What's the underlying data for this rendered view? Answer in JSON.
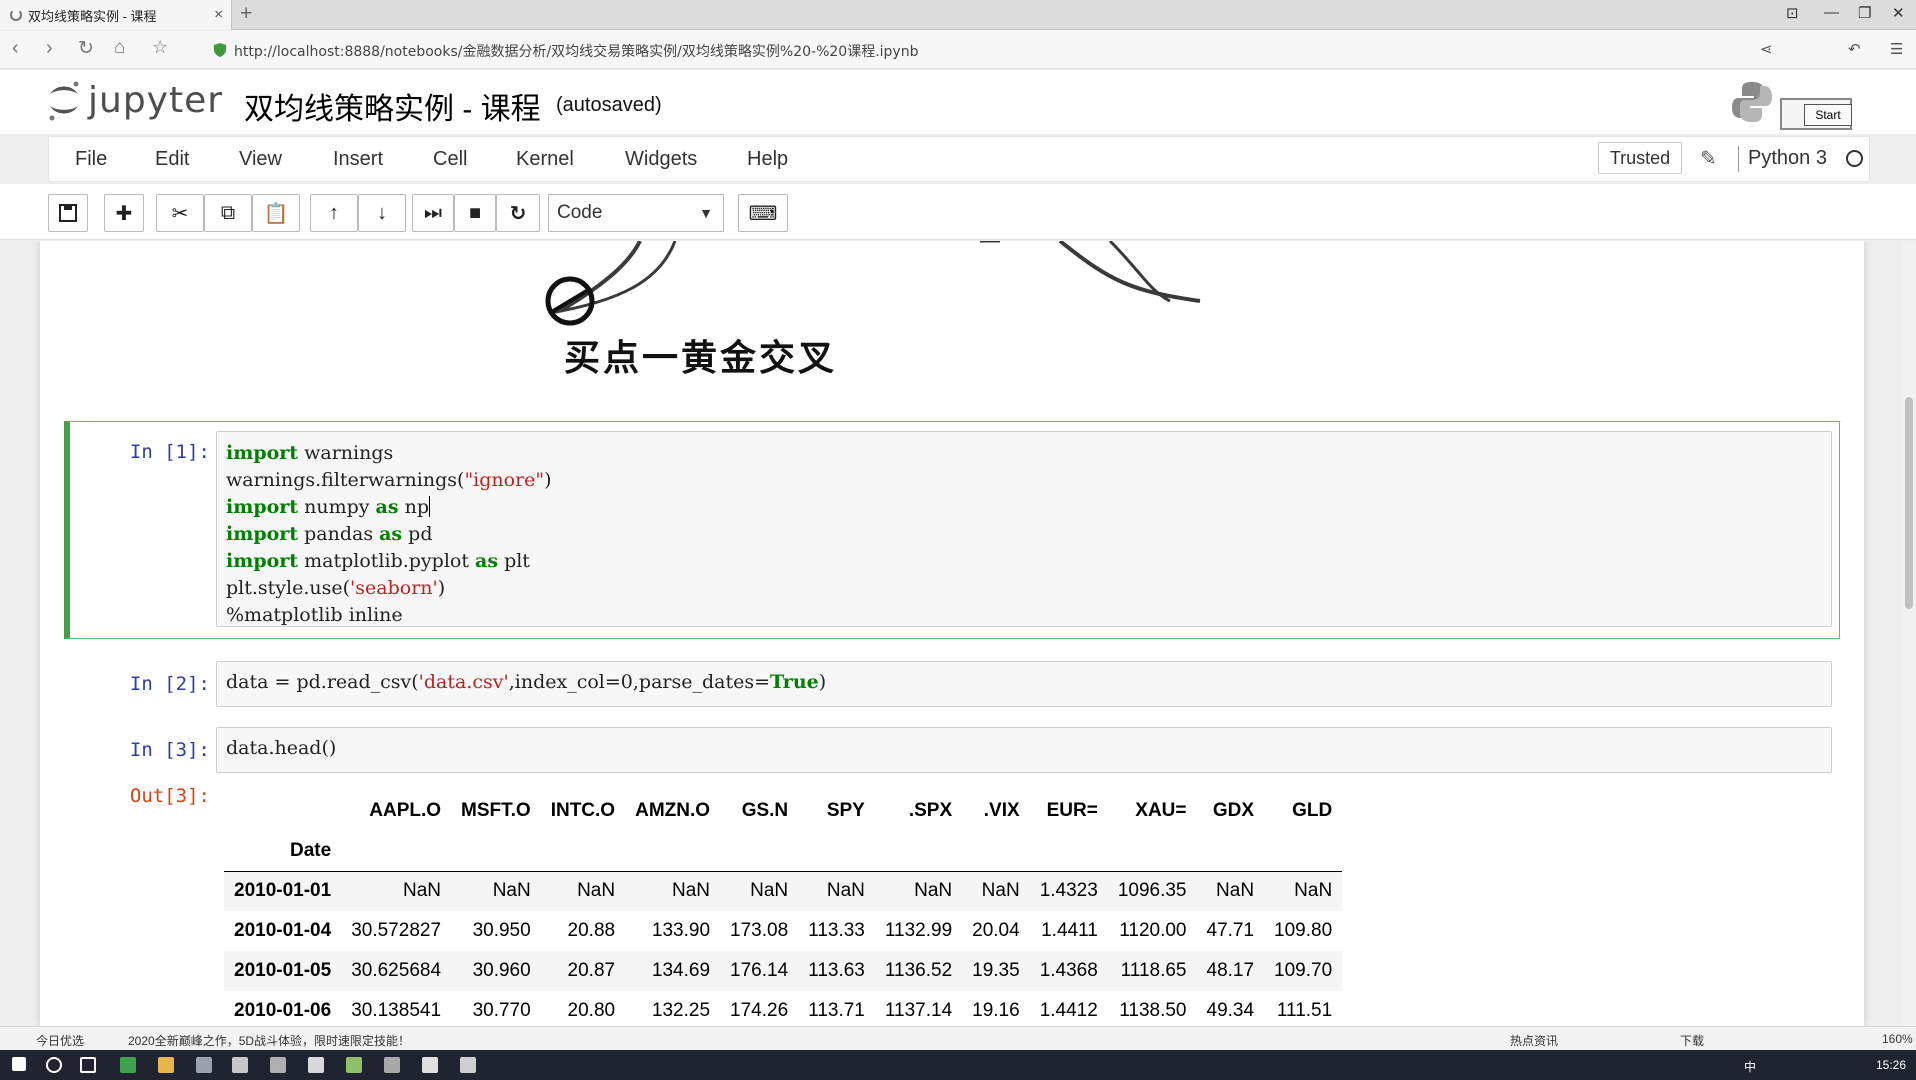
{
  "browser": {
    "tab_title": "双均线策略实例 - 课程",
    "tab_close": "×",
    "new_tab": "+",
    "url": "http://localhost:8888/notebooks/金融数据分析/双均线交易策略实例/双均线策略实例%20-%20课程.ipynb"
  },
  "jupyter": {
    "logo_text": "jupyter",
    "notebook_title": "双均线策略实例 - 课程",
    "autosaved": "(autosaved)",
    "start_label": "Start"
  },
  "menu": [
    "File",
    "Edit",
    "View",
    "Insert",
    "Cell",
    "Kernel",
    "Widgets",
    "Help"
  ],
  "trusted_label": "Trusted",
  "kernel_name": "Python 3",
  "toolbar": {
    "cell_type": "Code"
  },
  "figure": {
    "caption": "买点一黄金交叉"
  },
  "cells": [
    {
      "prompt": "In  [1]:",
      "lines": [
        "import warnings",
        "warnings.filterwarnings(\"ignore\")",
        "import numpy as np",
        "import pandas as pd",
        "import matplotlib.pyplot as plt",
        "plt.style.use('seaborn')",
        "%matplotlib inline"
      ]
    },
    {
      "prompt": "In  [2]:",
      "lines": [
        "data = pd.read_csv('data.csv',index_col=0,parse_dates=True)"
      ]
    },
    {
      "prompt": "In  [3]:",
      "lines": [
        "data.head()"
      ]
    }
  ],
  "output": {
    "prompt": "Out[3]:",
    "index_name": "Date",
    "columns": [
      "AAPL.O",
      "MSFT.O",
      "INTC.O",
      "AMZN.O",
      "GS.N",
      "SPY",
      ".SPX",
      ".VIX",
      "EUR=",
      "XAU=",
      "GDX",
      "GLD"
    ],
    "rows": [
      {
        "index": "2010-01-01",
        "values": [
          "NaN",
          "NaN",
          "NaN",
          "NaN",
          "NaN",
          "NaN",
          "NaN",
          "NaN",
          "1.4323",
          "1096.35",
          "NaN",
          "NaN"
        ]
      },
      {
        "index": "2010-01-04",
        "values": [
          "30.572827",
          "30.950",
          "20.88",
          "133.90",
          "173.08",
          "113.33",
          "1132.99",
          "20.04",
          "1.4411",
          "1120.00",
          "47.71",
          "109.80"
        ]
      },
      {
        "index": "2010-01-05",
        "values": [
          "30.625684",
          "30.960",
          "20.87",
          "134.69",
          "176.14",
          "113.63",
          "1136.52",
          "19.35",
          "1.4368",
          "1118.65",
          "48.17",
          "109.70"
        ]
      },
      {
        "index": "2010-01-06",
        "values": [
          "30.138541",
          "30.770",
          "20.80",
          "132.25",
          "174.26",
          "113.71",
          "1137.14",
          "19.16",
          "1.4412",
          "1138.50",
          "49.34",
          "111.51"
        ]
      }
    ]
  },
  "statusbar": {
    "left": "今日优选",
    "news": "2020全新巅峰之作，5D战斗体验，限时速限定技能！",
    "hot": "热点资讯",
    "download": "下载",
    "zoom": "160%"
  },
  "taskbar": {
    "lang": "中",
    "clock": "15:26"
  }
}
